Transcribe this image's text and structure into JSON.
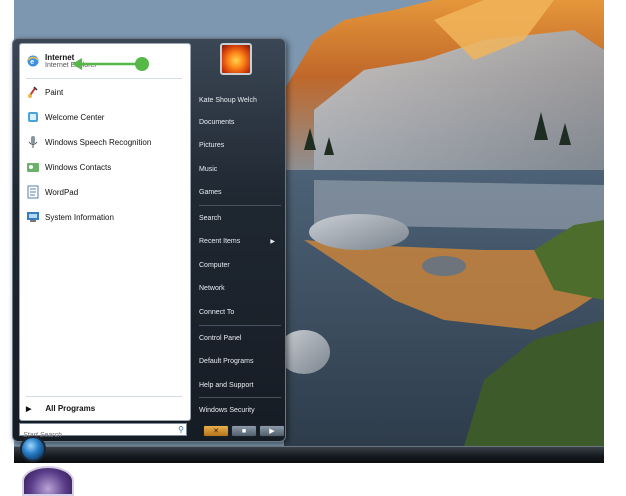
{
  "start_menu": {
    "pinned": [
      {
        "title": "Internet",
        "subtitle": "Internet Explorer",
        "icon": "internet-explorer-icon"
      }
    ],
    "recent": [
      {
        "label": "Paint",
        "icon": "paint-icon"
      },
      {
        "label": "Welcome Center",
        "icon": "welcome-center-icon"
      },
      {
        "label": "Windows Speech Recognition",
        "icon": "microphone-icon"
      },
      {
        "label": "Windows Contacts",
        "icon": "contacts-icon"
      },
      {
        "label": "WordPad",
        "icon": "wordpad-icon"
      },
      {
        "label": "System Information",
        "icon": "system-information-icon"
      }
    ],
    "all_programs": "All Programs",
    "search_placeholder": "Start Search",
    "right_items": [
      {
        "label": "Kate Shoup Welch"
      },
      {
        "label": "Documents"
      },
      {
        "label": "Pictures"
      },
      {
        "label": "Music"
      },
      {
        "label": "Games"
      },
      {
        "label": "Search"
      },
      {
        "label": "Recent Items"
      },
      {
        "label": "Computer"
      },
      {
        "label": "Network"
      },
      {
        "label": "Connect To"
      },
      {
        "label": "Control Panel"
      },
      {
        "label": "Default Programs"
      },
      {
        "label": "Help and Support"
      },
      {
        "label": "Windows Security"
      }
    ]
  },
  "annotation": {
    "color": "#55b848"
  },
  "colors": {
    "menu_dark": "#1f2731",
    "accent_blue": "#2b6fb5"
  }
}
